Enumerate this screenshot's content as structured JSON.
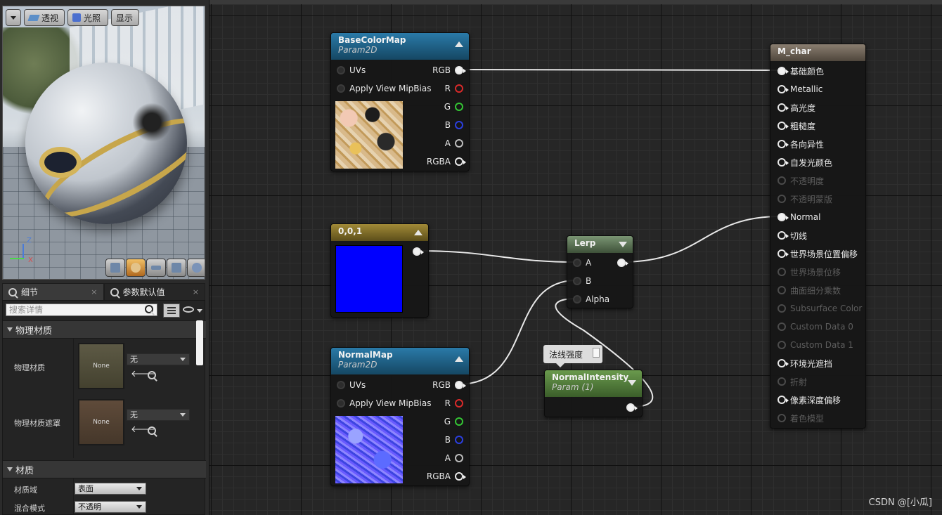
{
  "viewport": {
    "buttons": {
      "menu": "",
      "perspective": "透视",
      "lighting": "光照",
      "show": "显示"
    },
    "axis": {
      "z": "Z",
      "x": "X"
    }
  },
  "tabs": [
    {
      "label": "细节",
      "close": "×"
    },
    {
      "label": "参数默认值",
      "close": "×"
    }
  ],
  "details": {
    "search_placeholder": "搜索详情",
    "sections": {
      "physical": "物理材质",
      "material": "材质"
    },
    "physical_material": {
      "label": "物理材质",
      "thumb": "None",
      "value": "无"
    },
    "physical_mask": {
      "label": "物理材质遮罩",
      "thumb": "None",
      "value": "无"
    },
    "material_domain": {
      "label": "材质域",
      "value": "表面"
    },
    "blend_mode": {
      "label": "混合模式",
      "value": "不透明"
    }
  },
  "nodes": {
    "basecolor": {
      "title": "BaseColorMap",
      "subtitle": "Param2D",
      "inputs": [
        "UVs",
        "Apply View MipBias"
      ],
      "outputs": [
        "RGB",
        "R",
        "G",
        "B",
        "A",
        "RGBA"
      ]
    },
    "const": {
      "title": "0,0,1",
      "color": "#0000ff"
    },
    "normalmap": {
      "title": "NormalMap",
      "subtitle": "Param2D",
      "inputs": [
        "UVs",
        "Apply View MipBias"
      ],
      "outputs": [
        "RGB",
        "R",
        "G",
        "B",
        "A",
        "RGBA"
      ]
    },
    "lerp": {
      "title": "Lerp",
      "inputs": [
        "A",
        "B",
        "Alpha"
      ]
    },
    "intensity": {
      "title": "NormalIntensity",
      "subtitle": "Param (1)",
      "comment": "法线强度"
    },
    "material": {
      "title": "M_char",
      "pins": [
        {
          "label": "基础颜色",
          "state": "connected"
        },
        {
          "label": "Metallic",
          "state": "active"
        },
        {
          "label": "高光度",
          "state": "active"
        },
        {
          "label": "粗糙度",
          "state": "active"
        },
        {
          "label": "各向异性",
          "state": "active"
        },
        {
          "label": "自发光颜色",
          "state": "active"
        },
        {
          "label": "不透明度",
          "state": "disabled"
        },
        {
          "label": "不透明蒙版",
          "state": "disabled"
        },
        {
          "label": "Normal",
          "state": "connected"
        },
        {
          "label": "切线",
          "state": "active"
        },
        {
          "label": "世界场景位置偏移",
          "state": "active"
        },
        {
          "label": "世界场景位移",
          "state": "disabled"
        },
        {
          "label": "曲面细分乘数",
          "state": "disabled"
        },
        {
          "label": "Subsurface Color",
          "state": "disabled"
        },
        {
          "label": "Custom Data 0",
          "state": "disabled"
        },
        {
          "label": "Custom Data 1",
          "state": "disabled"
        },
        {
          "label": "环境光遮挡",
          "state": "active"
        },
        {
          "label": "折射",
          "state": "disabled"
        },
        {
          "label": "像素深度偏移",
          "state": "active"
        },
        {
          "label": "着色模型",
          "state": "disabled"
        }
      ]
    }
  },
  "watermark": "CSDN @[小瓜]",
  "colors": {
    "texture_header": "#1e5a7c",
    "const_header": "#7a6a28",
    "lerp_header": "#5a7055",
    "param_header": "#4a6f38",
    "material_header": "#6b6258",
    "wire": "#e8e8e8"
  }
}
